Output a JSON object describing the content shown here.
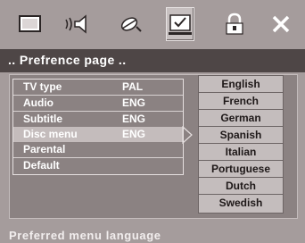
{
  "toolbar": {
    "icons": [
      "general-setup-icon",
      "audio-setup-icon",
      "video-setup-icon",
      "preference-setup-icon",
      "password-setup-icon",
      "exit-icon"
    ],
    "selected": "preference-setup-icon"
  },
  "title": ".. Prefrence page ..",
  "settings": [
    {
      "label": "TV type",
      "value": "PAL"
    },
    {
      "label": "Audio",
      "value": "ENG"
    },
    {
      "label": "Subtitle",
      "value": "ENG"
    },
    {
      "label": "Disc menu",
      "value": "ENG"
    },
    {
      "label": "Parental",
      "value": ""
    },
    {
      "label": "Default",
      "value": ""
    }
  ],
  "active_setting": "Disc menu",
  "options": [
    "English",
    "French",
    "German",
    "Spanish",
    "Italian",
    "Portuguese",
    "Dutch",
    "Swedish"
  ],
  "hint": "Preferred menu language",
  "colors": {
    "background": "#a59c9c",
    "title_bar": "#4e4646",
    "panel": "#8b8282",
    "highlight": "#c4bcbc"
  }
}
